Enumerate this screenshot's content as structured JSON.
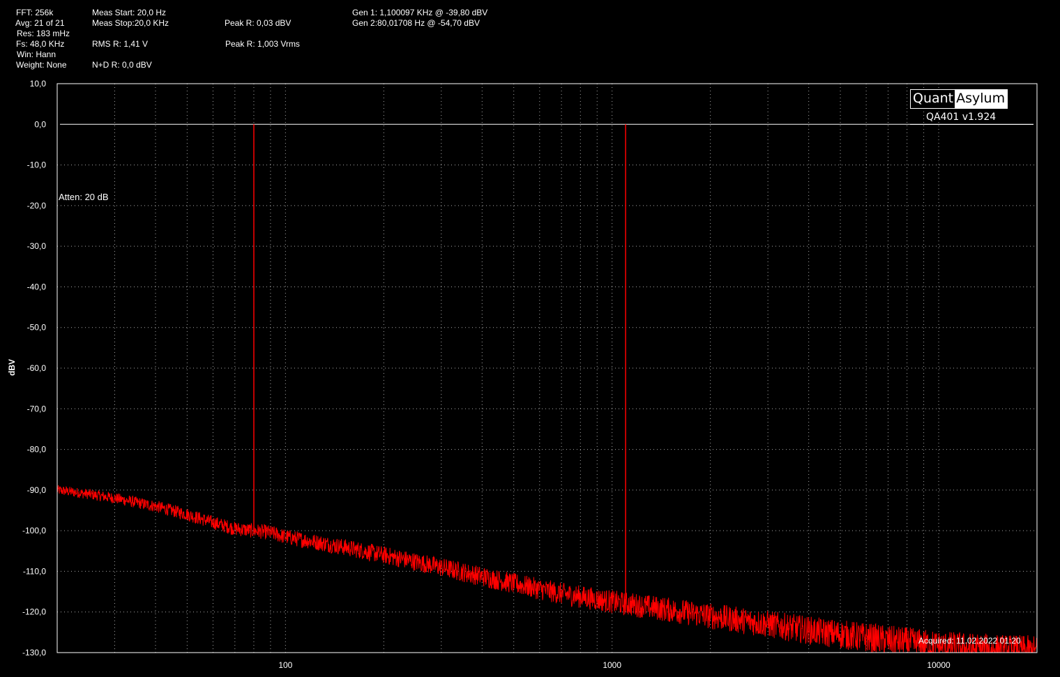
{
  "header": {
    "fft": "FFT: 256k",
    "avg": "Avg: 21 of 21",
    "res": "Res: 183 mHz",
    "fs": "Fs: 48,0 KHz",
    "win": "Win: Hann",
    "weight": "Weight: None",
    "meas_start": "Meas Start: 20,0 Hz",
    "meas_stop": "Meas Stop:20,0 KHz",
    "rms": "RMS R: 1,41 V",
    "nd": "N+D R: 0,0 dBV",
    "peak_dbv": "Peak R: 0,03 dBV",
    "peak_vrms": "Peak R: 1,003 Vrms",
    "gen1": "Gen 1: 1,100097 KHz @ -39,80  dBV",
    "gen2": "Gen 2:80,01708 Hz @ -54,70  dBV"
  },
  "logo": {
    "quant": "Quant",
    "asylum": "Asylum",
    "version": "QA401 v1.924"
  },
  "annotations": {
    "atten": "Atten: 20 dB",
    "acquired": "Acquired: 11.02.2022  01:20"
  },
  "colors": {
    "background": "#000000",
    "trace": "#ff0000",
    "grid": "#aaaaaa",
    "text": "#ffffff"
  },
  "chart_data": {
    "type": "line",
    "title": "",
    "xlabel": "",
    "ylabel": "dBV",
    "x_scale": "log",
    "xlim": [
      20,
      20000
    ],
    "ylim": [
      -130,
      10
    ],
    "grid": true,
    "yticks": [
      10,
      0,
      -10,
      -20,
      -30,
      -40,
      -50,
      -60,
      -70,
      -80,
      -90,
      -100,
      -110,
      -120,
      -130
    ],
    "ytick_labels": [
      "10,0",
      "0,0",
      "-10,0",
      "-20,0",
      "-30,0",
      "-40,0",
      "-50,0",
      "-60,0",
      "-70,0",
      "-80,0",
      "-90,0",
      "-100,0",
      "-110,0",
      "-120,0",
      "-130,0"
    ],
    "xticks": [
      100,
      1000,
      10000
    ],
    "xtick_labels": [
      "100",
      "1000",
      "10000"
    ],
    "reference_line_db": 0,
    "series": [
      {
        "x": [
          20,
          25,
          30,
          40,
          50,
          60,
          70,
          79.5,
          80.01708,
          80.5,
          90,
          100,
          150,
          200,
          300,
          500,
          700,
          1000,
          1090,
          1100.097,
          1110,
          1500,
          2000,
          3000,
          4000,
          4400,
          5000,
          7000,
          8000,
          10000,
          15000,
          20000
        ],
        "y": [
          -90,
          -91,
          -92,
          -94,
          -96,
          -98,
          -99.5,
          -100,
          0,
          -100,
          -100.5,
          -101.5,
          -104,
          -106,
          -109,
          -113,
          -115.5,
          -117.5,
          -118,
          0,
          -118,
          -119.5,
          -121,
          -123,
          -124.5,
          -125,
          -125.5,
          -127,
          -127.5,
          -128.5,
          -129.5,
          -130
        ]
      }
    ],
    "peaks": [
      {
        "x": 80.01708,
        "y": 0
      },
      {
        "x": 1100.097,
        "y": 0
      }
    ]
  }
}
